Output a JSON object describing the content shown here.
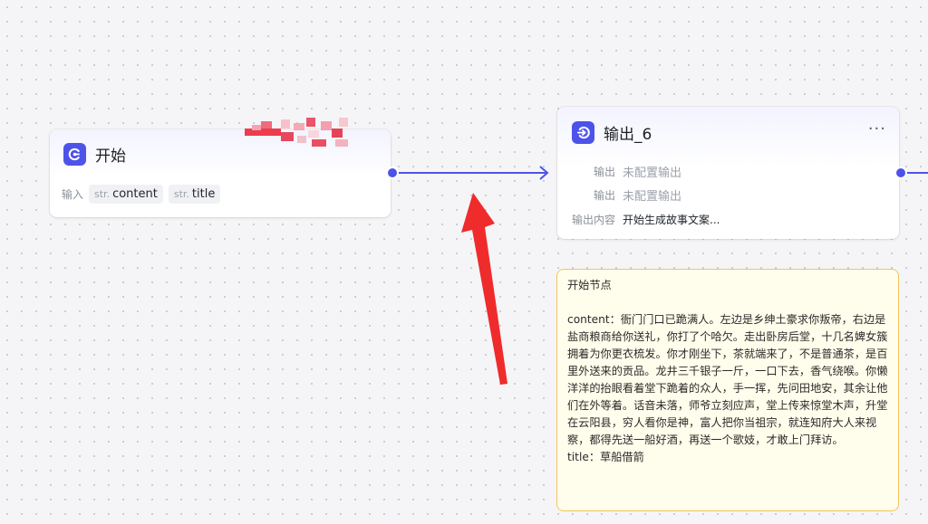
{
  "start_node": {
    "title": "开始",
    "input_label": "输入",
    "inputs": [
      {
        "type": "str.",
        "name": "content"
      },
      {
        "type": "str.",
        "name": "title"
      }
    ]
  },
  "output_node": {
    "title": "输出_6",
    "more_label": "···",
    "rows": [
      {
        "key": "输出",
        "value": "未配置输出"
      },
      {
        "key": "输出",
        "value": "未配置输出"
      },
      {
        "key": "输出内容",
        "value": "开始生成故事文案..."
      }
    ]
  },
  "preview_panel": {
    "heading": "开始节点",
    "content_line": "content：衙门门口已跪满人。左边是乡绅土豪求你叛帝，右边是盐商粮商给你送礼，你打了个哈欠。走出卧房后堂，十几名婢女簇拥着为你更衣梳发。你才刚坐下，茶就端来了，不是普通茶，是百里外送来的贡品。龙井三千银子一斤，一口下去，香气绕喉。你懒洋洋的抬眼看着堂下跪着的众人，手一挥，先问田地安，其余让他们在外等着。话音未落，师爷立刻应声，堂上传来惊堂木声，升堂在云阳县，穷人看你是神，富人把你当祖宗，就连知府大人来视察，都得先送一船好酒，再送一个歌妓，才敢上门拜访。",
    "title_line": "title：草船借箭"
  },
  "colors": {
    "accent": "#4d53e8",
    "arrow_annotation": "#ef2b2b",
    "preview_border": "#f5c45e",
    "preview_bg": "#fffdeb"
  }
}
